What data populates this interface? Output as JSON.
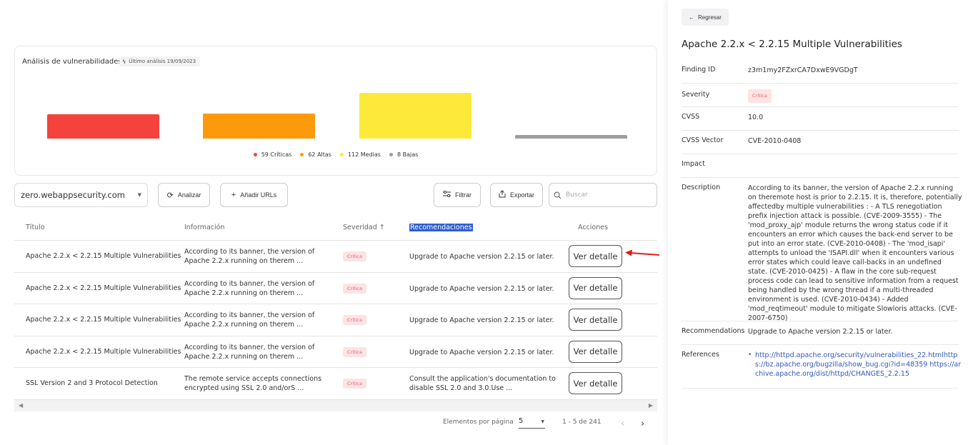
{
  "chart_data": {
    "type": "bar",
    "title": "Análisis de vulnerabilidades",
    "subtitle": "Último análisis 19/09/2023",
    "categories": [
      "Críticas",
      "Altas",
      "Medias",
      "Bajas"
    ],
    "values": [
      59,
      62,
      112,
      8
    ],
    "colors": [
      "#f4433c",
      "#fb9b0c",
      "#fde93a",
      "#9e9e9e"
    ],
    "legend": [
      {
        "label": "59 Críticas",
        "color": "#f4433c"
      },
      {
        "label": "62 Altas",
        "color": "#fb9b0c"
      },
      {
        "label": "112 Medias",
        "color": "#fde93a"
      },
      {
        "label": "8 Bajas",
        "color": "#9e9e9e"
      }
    ],
    "legend_position": "bottom",
    "grid": false,
    "xlabel": "",
    "ylabel": ""
  },
  "toolbar": {
    "target_value": "zero.webappsecurity.com",
    "analyze_label": "Analizar",
    "add_urls_label": "Añadir URLs",
    "filter_label": "Filtrar",
    "export_label": "Exportar",
    "search_placeholder": "Buscar"
  },
  "table": {
    "headers": {
      "title": "Título",
      "info": "Información",
      "severity": "Severidad",
      "severity_sort": "↑",
      "recommendations": "Recomendaciones",
      "actions": "Acciones"
    },
    "rows": [
      {
        "title": "Apache 2.2.x < 2.2.15 Multiple Vulnerabilities",
        "info": "According to its banner, the version of Apache 2.2.x running on therem ...",
        "severity": "Crítica",
        "rec": "Upgrade to Apache version 2.2.15 or later.",
        "action": "Ver detalle"
      },
      {
        "title": "Apache 2.2.x < 2.2.15 Multiple Vulnerabilities",
        "info": "According to its banner, the version of Apache 2.2.x running on therem ...",
        "severity": "Crítica",
        "rec": "Upgrade to Apache version 2.2.15 or later.",
        "action": "Ver detalle"
      },
      {
        "title": "Apache 2.2.x < 2.2.15 Multiple Vulnerabilities",
        "info": "According to its banner, the version of Apache 2.2.x running on therem ...",
        "severity": "Crítica",
        "rec": "Upgrade to Apache version 2.2.15 or later.",
        "action": "Ver detalle"
      },
      {
        "title": "Apache 2.2.x < 2.2.15 Multiple Vulnerabilities",
        "info": "According to its banner, the version of Apache 2.2.x running on therem ...",
        "severity": "Crítica",
        "rec": "Upgrade to Apache version 2.2.15 or later.",
        "action": "Ver detalle"
      },
      {
        "title": "SSL Version 2 and 3 Protocol Detection",
        "info": "The remote service accepts connections encrypted using SSL 2.0 and/orS ...",
        "severity": "Crítica",
        "rec": "Consult the application's documentation to disable SSL 2.0 and 3.0.Use ...",
        "action": "Ver detalle"
      }
    ]
  },
  "pagination": {
    "per_page_label": "Elementos por página",
    "per_page_value": "5",
    "range": "1 - 5 de 241"
  },
  "detail": {
    "back_label": "Regresar",
    "title": "Apache 2.2.x < 2.2.15 Multiple Vulnerabilities",
    "finding_id_label": "Finding ID",
    "finding_id": "z3m1my2FZxrCA7DxwE9VGDgT",
    "severity_label": "Severity",
    "severity": "Crítica",
    "cvss_label": "CVSS",
    "cvss": "10.0",
    "cvss_vector_label": "CVSS Vector",
    "cvss_vector": "CVE-2010-0408",
    "impact_label": "Impact",
    "impact": "",
    "description_label": "Description",
    "description": "According to its banner, the version of Apache 2.2.x running on theremote host is prior to 2.2.15. It is, therefore, potentially affectedby multiple vulnerabilities : - A TLS renegotiation prefix injection attack is possible. (CVE-2009-3555) - The 'mod_proxy_ajp' module returns the wrong status code if it encounters an error which causes the back-end server to be put into an error state. (CVE-2010-0408) - The 'mod_isapi' attempts to unload the 'ISAPI.dll' when it encounters various error states which could leave call-backs in an undefined state. (CVE-2010-0425) - A flaw in the core sub-request process code can lead to sensitive information from a request being handled by the wrong thread if a multi-threaded environment is used. (CVE-2010-0434) - Added 'mod_reqtimeout' module to mitigate Slowloris attacks. (CVE-2007-6750)",
    "recommendations_label": "Recommendations",
    "recommendations": "Upgrade to Apache version 2.2.15 or later.",
    "references_label": "References",
    "references": "http://httpd.apache.org/security/vulnerabilities_22.htmlhttps://bz.apache.org/bugzilla/show_bug.cgi?id=48359 https://archive.apache.org/dist/httpd/CHANGES_2.2.15"
  }
}
